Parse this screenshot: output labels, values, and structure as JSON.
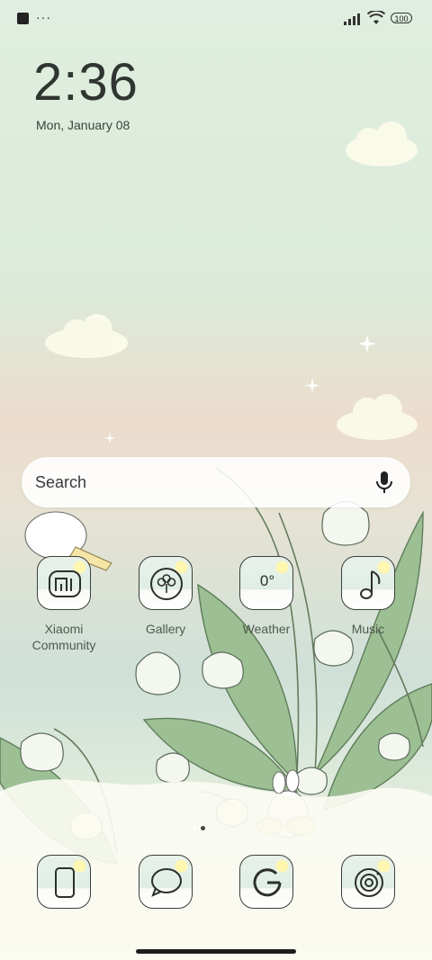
{
  "status_bar": {
    "battery": "100",
    "more_indicator": "···",
    "icons": [
      "notification-square-icon",
      "signal-icon",
      "wifi-icon",
      "battery-icon"
    ]
  },
  "lockscreen": {
    "time": "2:36",
    "date": "Mon, January 08"
  },
  "search": {
    "placeholder": "Search",
    "icon": "mic-icon"
  },
  "apps_row1": [
    {
      "label": "Xiaomi Community",
      "icon": "mi-logo-icon"
    },
    {
      "label": "Gallery",
      "icon": "flower-icon"
    },
    {
      "label": "Weather",
      "icon": "weather-icon",
      "tile_text": "0°"
    },
    {
      "label": "Music",
      "icon": "music-note-icon"
    }
  ],
  "dock": [
    {
      "icon": "phone-icon"
    },
    {
      "icon": "message-bubble-icon"
    },
    {
      "icon": "google-icon"
    },
    {
      "icon": "camera-icon"
    }
  ],
  "pager": {
    "pages": 2,
    "active": 1
  },
  "colors": {
    "tile_border": "#3b3f3a",
    "label": "#4e5a4e",
    "leaf": "#8fb58a"
  }
}
